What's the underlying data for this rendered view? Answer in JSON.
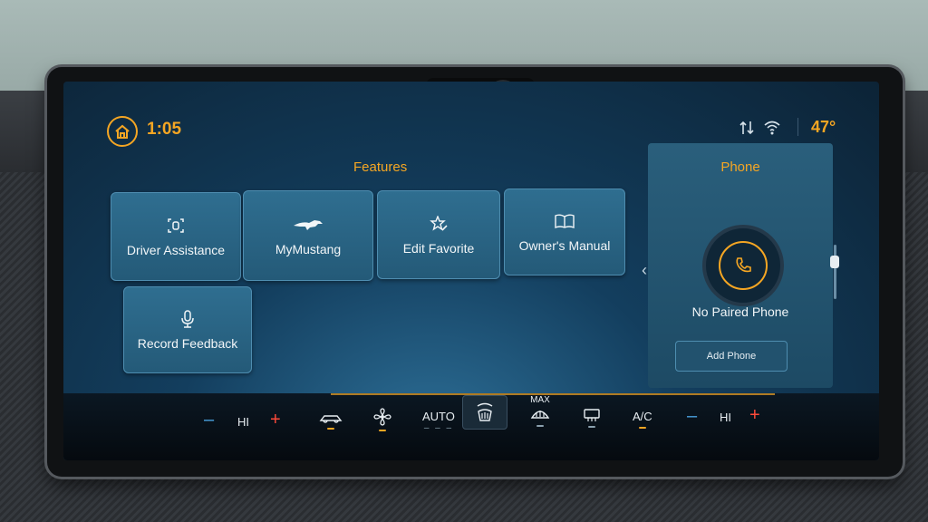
{
  "status": {
    "time": "1:05",
    "temperature": "47°",
    "icons": [
      "home-icon",
      "data-transfer-icon",
      "wifi-icon"
    ]
  },
  "features": {
    "title": "Features",
    "tiles": [
      {
        "label": "Driver Assistance",
        "icon": "driver-assist-icon"
      },
      {
        "label": "MyMustang",
        "icon": "mustang-pony-icon"
      },
      {
        "label": "Edit Favorite",
        "icon": "star-edit-icon"
      },
      {
        "label": "Owner's Manual",
        "icon": "book-icon"
      },
      {
        "label": "Record Feedback",
        "icon": "microphone-icon"
      }
    ]
  },
  "phone": {
    "title": "Phone",
    "status": "No Paired Phone",
    "add_label": "Add Phone"
  },
  "climate": {
    "left_fan_level": "HI",
    "right_fan_level": "HI",
    "auto_label": "AUTO",
    "max_label": "MAX",
    "ac_label": "A/C"
  },
  "colors": {
    "accent": "#f5a623",
    "tile": "#2b6788",
    "minus": "#4aa3e0",
    "plus": "#ff4a3a"
  }
}
